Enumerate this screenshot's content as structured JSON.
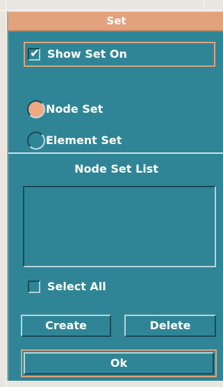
{
  "dialog": {
    "title": "Set",
    "show_set_on": {
      "label": "Show Set On",
      "checked": true
    },
    "set_type": {
      "options": [
        "Node Set",
        "Element Set"
      ],
      "selected": "Node Set"
    },
    "list_title": "Node Set List",
    "list_items": [],
    "select_all": {
      "label": "Select All",
      "checked": false
    },
    "buttons": {
      "create": "Create",
      "delete": "Delete",
      "ok": "Ok"
    }
  },
  "colors": {
    "panel": "#2f8596",
    "titlebar": "#e1a27d",
    "accent_border": "#e1a27d",
    "radio_selected": "#f0a882",
    "text": "#ffffff"
  },
  "icons": {
    "check": "check-mark-icon"
  }
}
